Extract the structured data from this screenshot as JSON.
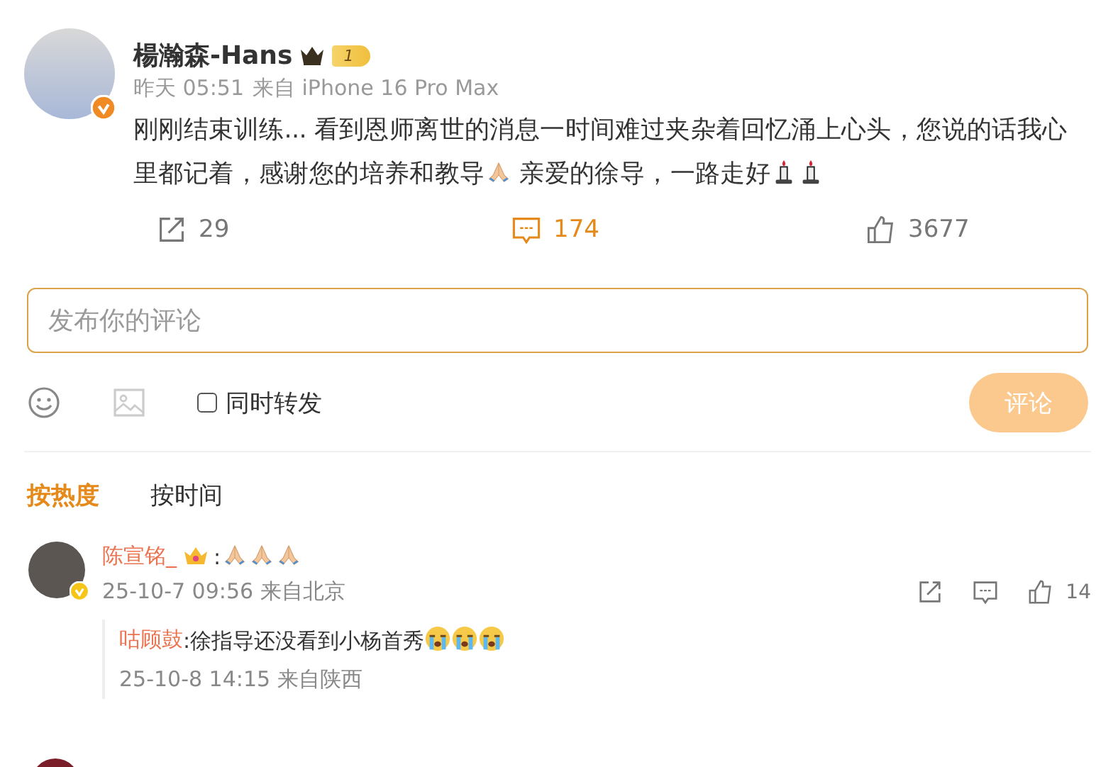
{
  "post": {
    "author": "楊瀚森-Hans",
    "verified": true,
    "member_level": "1",
    "time": "昨天 05:51",
    "source": "来自 iPhone 16 Pro Max",
    "content": [
      {
        "kind": "text",
        "text": "刚刚结束训练... 看到恩师离世的消息一时间难过夹杂着回忆涌上心头，您说的话我心里都记着，感谢您的培养和教导"
      },
      {
        "kind": "pray"
      },
      {
        "kind": "text",
        "text": " 亲爱的徐导，一路走好"
      },
      {
        "kind": "candle"
      },
      {
        "kind": "candle"
      }
    ],
    "actions": [
      {
        "kind": "share",
        "count": "29",
        "active": false
      },
      {
        "kind": "comment",
        "count": "174",
        "active": true
      },
      {
        "kind": "like",
        "count": "3677",
        "active": false
      }
    ]
  },
  "composer": {
    "placeholder": "发布你的评论",
    "repost_label": "同时转发",
    "repost_checked": false,
    "submit": "评论"
  },
  "sort_tabs": [
    {
      "label": "按热度",
      "selected": true
    },
    {
      "label": "按时间",
      "selected": false
    }
  ],
  "comments": [
    {
      "author": "陈宣铭_",
      "verified": true,
      "content": [
        {
          "kind": "text",
          "text": ":"
        },
        {
          "kind": "pray"
        },
        {
          "kind": "pray"
        },
        {
          "kind": "pray"
        }
      ],
      "meta": "25-10-7 09:56 来自北京",
      "like_count": "14",
      "replies": [
        {
          "author": "咕顾鼓",
          "content": [
            {
              "kind": "text",
              "text": ":徐指导还没看到小杨首秀"
            },
            {
              "kind": "cry"
            },
            {
              "kind": "cry"
            },
            {
              "kind": "cry"
            }
          ],
          "meta": "25-10-8 14:15 来自陕西"
        }
      ]
    }
  ]
}
